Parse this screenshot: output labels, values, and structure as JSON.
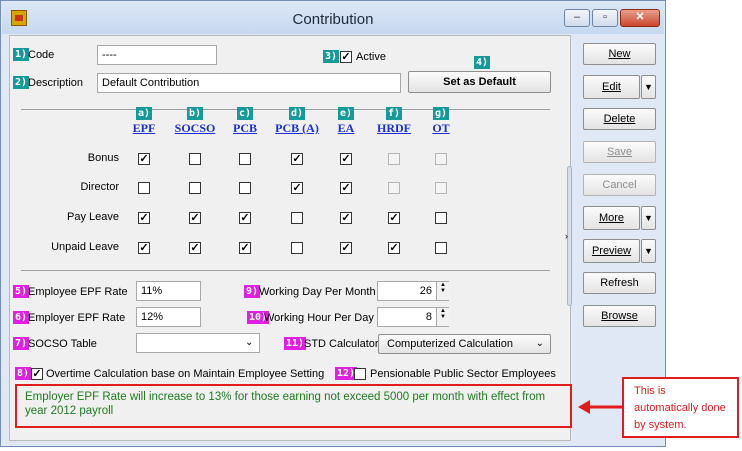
{
  "window": {
    "title": "Contribution",
    "controls": [
      "–",
      "▫",
      "✕"
    ]
  },
  "form": {
    "code": {
      "badge": "1)",
      "label": "Code",
      "value": "----"
    },
    "description": {
      "badge": "2)",
      "label": "Description",
      "value": "Default Contribution"
    },
    "active": {
      "badge": "3)",
      "label": "Active",
      "checked": true
    },
    "set_default": {
      "badge": "4)",
      "label": "Set as Default"
    }
  },
  "columns": [
    {
      "badge": "a)",
      "label": "EPF"
    },
    {
      "badge": "b)",
      "label": "SOCSO"
    },
    {
      "badge": "c)",
      "label": "PCB"
    },
    {
      "badge": "d)",
      "label": "PCB (A)"
    },
    {
      "badge": "e)",
      "label": "EA"
    },
    {
      "badge": "f)",
      "label": "HRDF"
    },
    {
      "badge": "g)",
      "label": "OT"
    }
  ],
  "rows": [
    {
      "label": "Bonus",
      "checks": [
        true,
        false,
        false,
        true,
        true,
        "disabled",
        "disabled"
      ]
    },
    {
      "label": "Director",
      "checks": [
        false,
        false,
        false,
        true,
        true,
        "disabled",
        "disabled"
      ]
    },
    {
      "label": "Pay Leave",
      "checks": [
        true,
        true,
        true,
        false,
        true,
        true,
        false
      ]
    },
    {
      "label": "Unpaid Leave",
      "checks": [
        true,
        true,
        true,
        false,
        true,
        true,
        false
      ]
    }
  ],
  "rates": {
    "employee_epf": {
      "badge": "5)",
      "label": "Employee EPF Rate",
      "value": "11%"
    },
    "employer_epf": {
      "badge": "6)",
      "label": "Employer EPF Rate",
      "value": "12%"
    },
    "socso_table": {
      "badge": "7)",
      "label": "SOCSO Table",
      "value": ""
    },
    "working_day": {
      "badge": "9)",
      "label": "Working Day Per Month",
      "value": "26"
    },
    "working_hour": {
      "badge": "10)",
      "label": "Working Hour Per Day",
      "value": "8"
    },
    "std_calculator": {
      "badge": "11)",
      "label": "STD Calculator",
      "value": "Computerized Calculation"
    }
  },
  "options": {
    "overtime": {
      "badge": "8)",
      "label": "Overtime Calculation base on Maintain Employee Setting",
      "checked": true
    },
    "pensionable": {
      "badge": "12)",
      "label": "Pensionable Public Sector Employees",
      "checked": false
    }
  },
  "notice": "Employer EPF Rate will increase to 13% for those earning not exceed 5000 per month with effect from year 2012 payroll",
  "callout": "This is automatically done by system.",
  "buttons": {
    "new": "New",
    "edit": "Edit",
    "delete": "Delete",
    "save": "Save",
    "cancel": "Cancel",
    "more": "More",
    "preview": "Preview",
    "refresh": "Refresh",
    "browse": "Browse"
  },
  "colors": {
    "accent_border": "#e31b1b",
    "badge_teal": "#159a9a",
    "badge_magenta": "#e020e0",
    "column_header": "#1b2fd1",
    "notice_text": "#1f7a1f"
  }
}
